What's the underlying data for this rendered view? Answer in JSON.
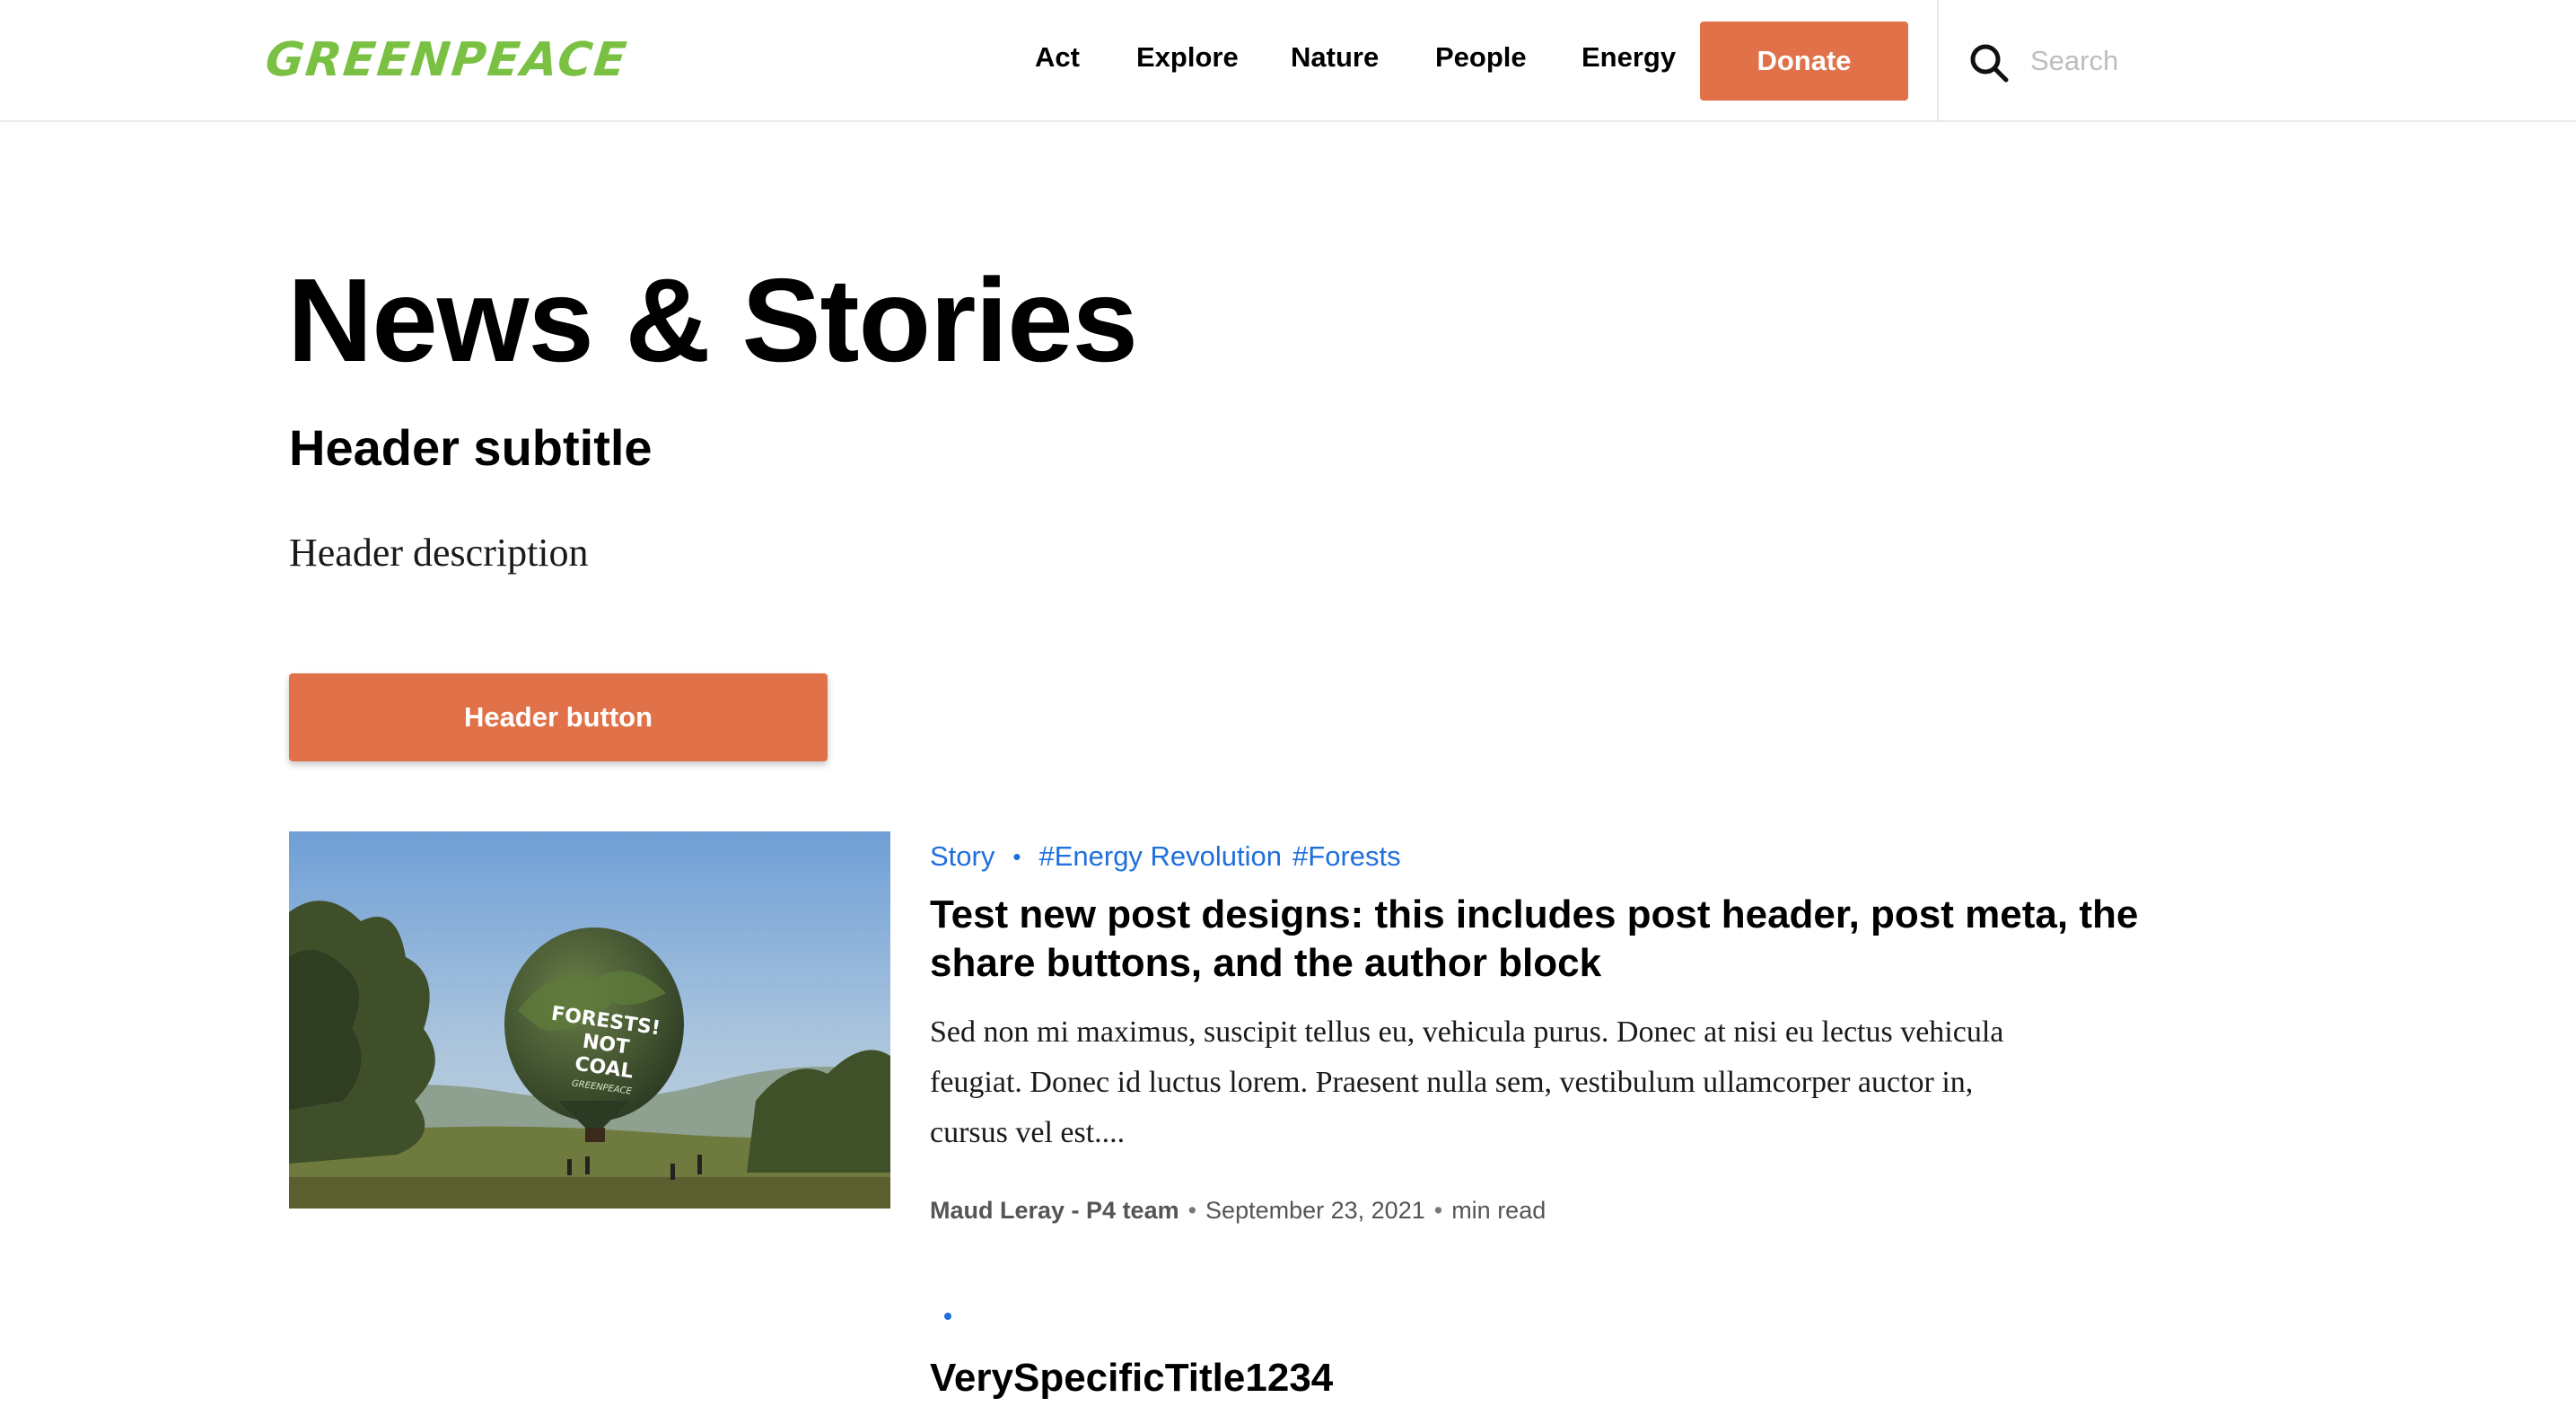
{
  "nav": {
    "logo_text": "GREENPEACE",
    "items": [
      {
        "label": "Act"
      },
      {
        "label": "Explore"
      },
      {
        "label": "Nature"
      },
      {
        "label": "People"
      },
      {
        "label": "Energy"
      }
    ],
    "donate_label": "Donate",
    "search_placeholder": "Search"
  },
  "header": {
    "title": "News & Stories",
    "subtitle": "Header subtitle",
    "description": "Header description",
    "button_label": "Header button"
  },
  "posts": [
    {
      "type": "Story",
      "tags": [
        "#Energy Revolution",
        "#Forests"
      ],
      "title": "Test new post designs: this includes post header, post meta, the share buttons, and the author block",
      "excerpt": "Sed non mi maximus, suscipit tellus eu, vehicula purus. Donec at nisi eu lectus vehicula feugiat. Donec id luctus lorem. Praesent nulla sem, vestibulum ullamcorper auctor in, cursus vel est....",
      "author": "Maud Leray - P4 team",
      "date": "September 23, 2021",
      "read_time": "min read",
      "image": {
        "balloon_text": [
          "FORESTS!",
          "NOT",
          "COAL"
        ],
        "balloon_brand": "GREENPEACE"
      }
    },
    {
      "title": "VerySpecificTitle1234"
    }
  ],
  "colors": {
    "brand_green": "#7ac143",
    "accent_orange": "#e07148",
    "link_blue": "#1f6fdc"
  },
  "icons": {
    "search": "search-icon"
  }
}
